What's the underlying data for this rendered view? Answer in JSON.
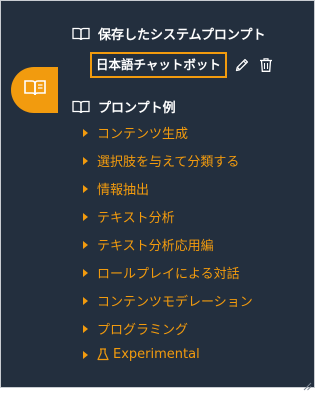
{
  "sidebar": {
    "rail_icon": "book-open-icon",
    "saved_section": {
      "icon": "book-open-icon",
      "title": "保存したシステムプロンプト",
      "items": [
        {
          "label": "日本語チャットボット",
          "edit_icon": "pencil-icon",
          "delete_icon": "trash-icon"
        }
      ]
    },
    "examples_section": {
      "icon": "book-open-icon",
      "title": "プロンプト例",
      "items": [
        {
          "label": "コンテンツ生成"
        },
        {
          "label": "選択肢を与えて分類する"
        },
        {
          "label": "情報抽出"
        },
        {
          "label": "テキスト分析"
        },
        {
          "label": "テキスト分析応用編"
        },
        {
          "label": "ロールプレイによる対話"
        },
        {
          "label": "コンテンツモデレーション"
        },
        {
          "label": "プログラミング"
        },
        {
          "label": "Experimental",
          "icon": "flask-icon"
        }
      ]
    }
  },
  "colors": {
    "panel_bg": "#232f3e",
    "accent": "#f29b0e",
    "text": "#ffffff"
  }
}
